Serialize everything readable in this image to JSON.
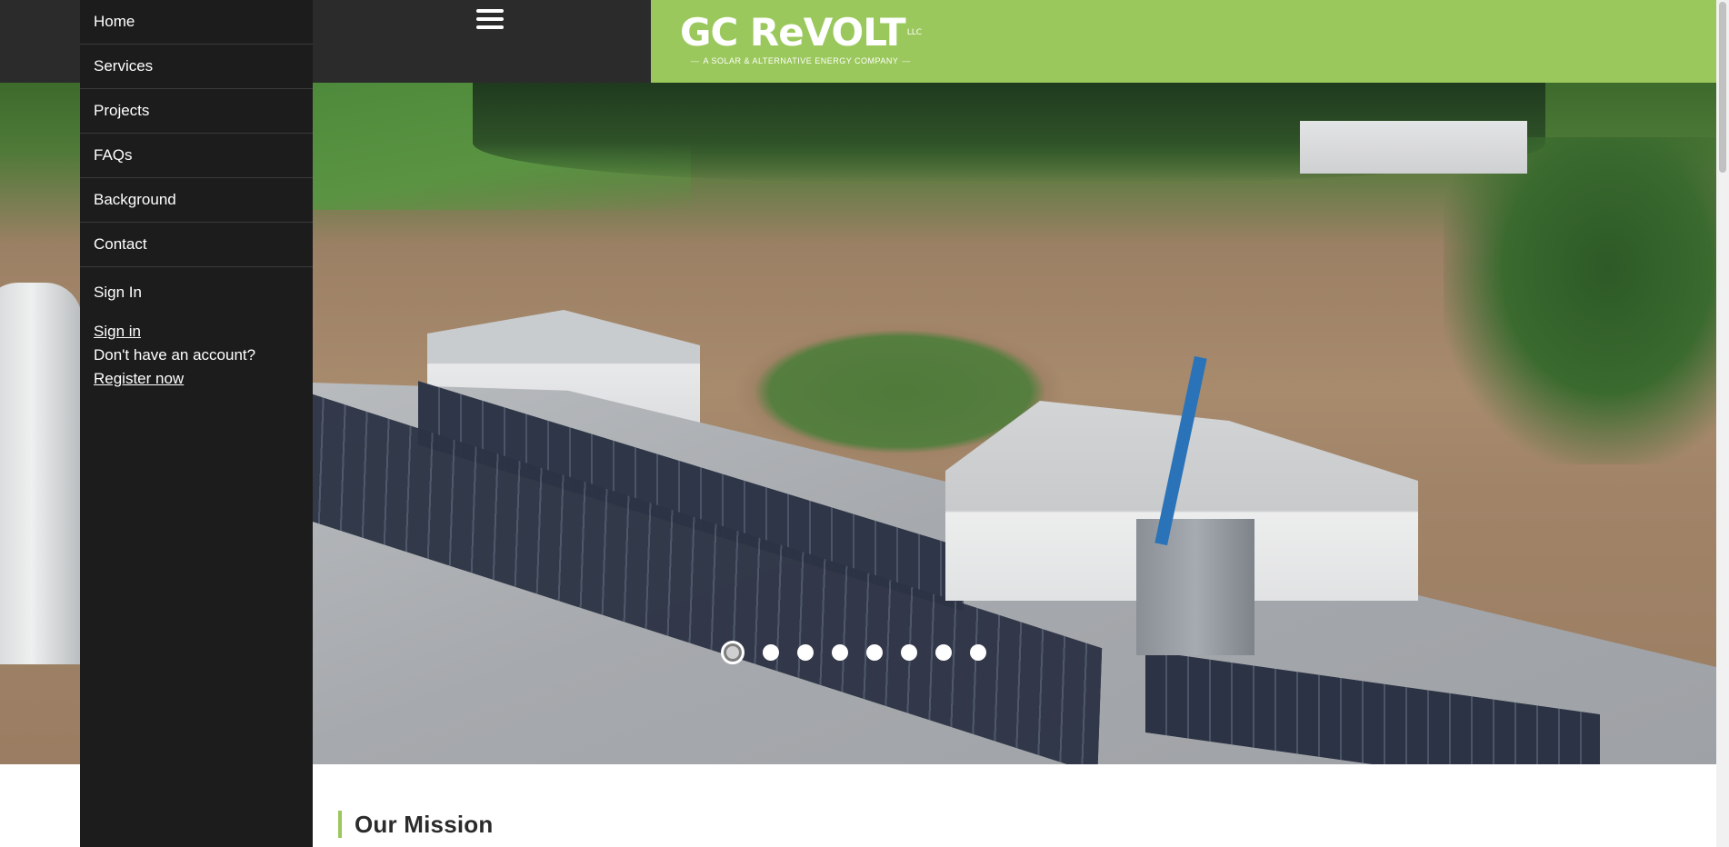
{
  "colors": {
    "accent_green": "#9bc85c",
    "menu_bg": "#1c1c1c",
    "topbar_bg": "#2b2b2b"
  },
  "header": {
    "menu_icon": "hamburger-icon",
    "logo": {
      "name": "GC ReVOLT",
      "suffix": "LLC",
      "tagline": "A SOLAR & ALTERNATIVE ENERGY COMPANY"
    }
  },
  "nav": {
    "items": [
      {
        "label": "Home"
      },
      {
        "label": "Services"
      },
      {
        "label": "Projects"
      },
      {
        "label": "FAQs"
      },
      {
        "label": "Background"
      },
      {
        "label": "Contact"
      }
    ]
  },
  "signin": {
    "heading": "Sign In",
    "link_label": "Sign in",
    "no_account_text": "Don't have an account?",
    "register_label": "Register now"
  },
  "carousel": {
    "slide_count": 8,
    "active_index": 0
  },
  "mission": {
    "title": "Our Mission"
  }
}
